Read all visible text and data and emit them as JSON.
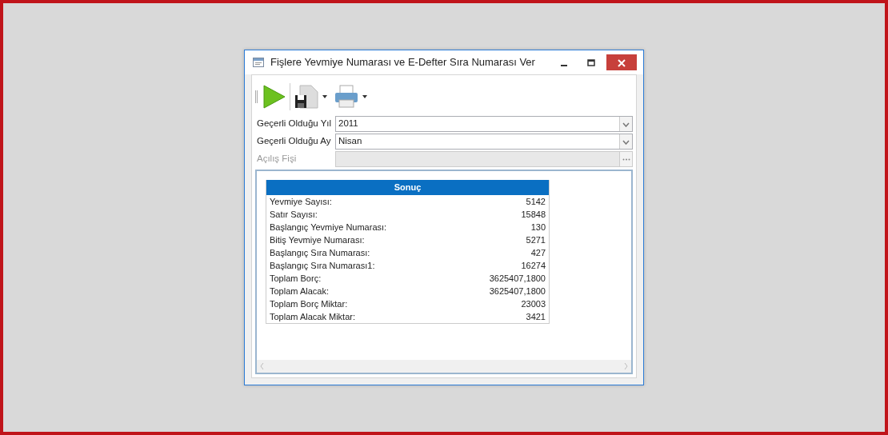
{
  "window": {
    "title": "Fişlere Yevmiye Numarası ve E-Defter Sıra Numarası Ver"
  },
  "fields": [
    {
      "label": "Geçerli Olduğu Yıl",
      "value": "2011",
      "kind": "dropdown",
      "disabled": false
    },
    {
      "label": "Geçerli Olduğu Ay",
      "value": "Nisan",
      "kind": "dropdown",
      "disabled": false
    },
    {
      "label": "Açılış Fişi",
      "kind": "lookup",
      "disabled": true
    }
  ],
  "result": {
    "title": "Sonuç",
    "rows": [
      {
        "label": "Yevmiye Sayısı:",
        "value": "5142"
      },
      {
        "label": "Satır Sayısı:",
        "value": "15848"
      },
      {
        "label": "Başlangıç Yevmiye Numarası:",
        "value": "130"
      },
      {
        "label": "Bitiş Yevmiye Numarası:",
        "value": "5271"
      },
      {
        "label": "Başlangıç Sıra Numarası:",
        "value": "427"
      },
      {
        "label": "Başlangıç Sıra Numarası1:",
        "value": "16274"
      },
      {
        "label": "Toplam Borç:",
        "value": "3625407,1800"
      },
      {
        "label": "Toplam Alacak:",
        "value": "3625407,1800"
      },
      {
        "label": "Toplam Borç Miktar:",
        "value": "23003"
      },
      {
        "label": "Toplam Alacak Miktar:",
        "value": "3421"
      }
    ]
  }
}
